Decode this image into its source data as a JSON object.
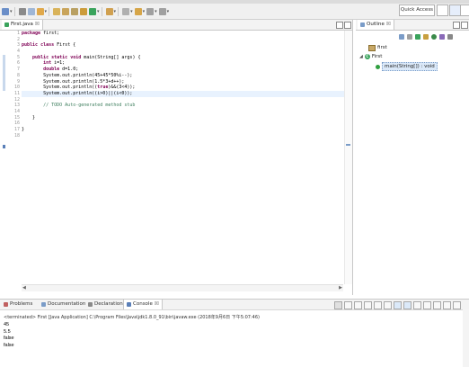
{
  "toolbar": {
    "quick_access": "Quick Access"
  },
  "editor": {
    "tab_label": "First.java",
    "line_numbers": [
      "1",
      "2",
      "3",
      "4",
      "5",
      "6",
      "7",
      "8",
      "9",
      "10",
      "11",
      "12",
      "13",
      "14",
      "15",
      "16",
      "17",
      "18"
    ],
    "lines": [
      "package first;",
      "",
      "public class First {",
      "",
      "    public static void main(String[] args) {",
      "        int i=1;",
      "        double d=1.0;",
      "        System.out.println(45+45*50%i--);",
      "        System.out.println(1.5*3+d++);",
      "        System.out.println((true)&&(3<4));",
      "        System.out.println((i>0)||(i<0));",
      "",
      "        // TODO Auto-generated method stub",
      "",
      "    }",
      "",
      "}",
      ""
    ]
  },
  "outline": {
    "tab_label": "Outline",
    "package": "first",
    "class": "First",
    "method": "main(String[]) : void"
  },
  "bottom": {
    "tabs": [
      "Problems",
      "Documentation",
      "Declaration",
      "Console"
    ],
    "console_desc": "<terminated> First [Java Application] C:\\Program Files\\Java\\jdk1.8.0_91\\bin\\javaw.exe (2018年9月6日 下午5:07:46)",
    "output": [
      "45",
      "5.5",
      "false",
      "false"
    ]
  },
  "colors": {
    "keyword": "#7f0055",
    "comment": "#3f7f5f",
    "current_line": "#e8f2fe"
  }
}
